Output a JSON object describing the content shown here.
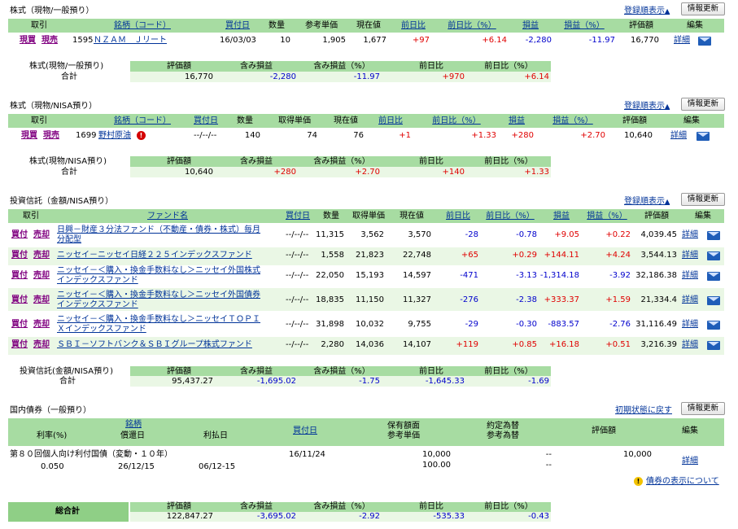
{
  "common": {
    "buy": "現買",
    "sell": "現売",
    "inv_buy": "買付",
    "inv_sell": "売却",
    "detail": "詳細",
    "info_update": "情報更新",
    "sort_show": "登録順表示",
    "sort_arrow": "▲"
  },
  "s1": {
    "title": "株式（現物/一般預り）",
    "headers": [
      "取引",
      "銘柄（コード）",
      "買付日",
      "数量",
      "参考単価",
      "現在値",
      "前日比",
      "前日比（%）",
      "損益",
      "損益（%）",
      "評価額",
      "編集"
    ],
    "row": {
      "code": "1595",
      "name": "ＮＺＡＭ　Ｊリート",
      "date": "16/03/03",
      "qty": "10",
      "ref": "1,905",
      "price": "1,677",
      "chg": "+97",
      "chgp": "+6.14",
      "pl": "-2,280",
      "plp": "-11.97",
      "val": "16,770"
    },
    "sum_label1": "株式(現物/一般預り)",
    "sum_label2": "合計",
    "sum_headers": [
      "評価額",
      "含み損益",
      "含み損益（%）",
      "前日比",
      "前日比（%）"
    ],
    "sum": [
      "16,770",
      "-2,280",
      "-11.97",
      "+970",
      "+6.14"
    ]
  },
  "s2": {
    "title": "株式（現物/NISA預り）",
    "headers": [
      "取引",
      "銘柄（コード）",
      "買付日",
      "数量",
      "取得単価",
      "現在値",
      "前日比",
      "前日比（%）",
      "損益",
      "損益（%）",
      "評価額",
      "編集"
    ],
    "row": {
      "code": "1699",
      "name": "野村原油",
      "date": "--/--/--",
      "qty": "140",
      "ref": "74",
      "price": "76",
      "chg": "+1",
      "chgp": "+1.33",
      "pl": "+280",
      "plp": "+2.70",
      "val": "10,640"
    },
    "sum_label1": "株式(現物/NISA預り)",
    "sum_label2": "合計",
    "sum_headers": [
      "評価額",
      "含み損益",
      "含み損益（%）",
      "前日比",
      "前日比（%）"
    ],
    "sum": [
      "10,640",
      "+280",
      "+2.70",
      "+140",
      "+1.33"
    ]
  },
  "s3": {
    "title": "投資信託（金額/NISA預り）",
    "headers": [
      "取引",
      "ファンド名",
      "買付日",
      "数量",
      "取得単価",
      "現在値",
      "前日比",
      "前日比（%）",
      "損益",
      "損益（%）",
      "評価額",
      "編集"
    ],
    "rows": [
      {
        "n1": "日興－財産３分法ファンド（不動産・債券・株式）毎月",
        "n2": "分配型",
        "date": "--/--/--",
        "qty": "11,315",
        "ref": "3,562",
        "price": "3,570",
        "chg": "-28",
        "chgp": "-0.78",
        "pl": "+9.05",
        "plp": "+0.22",
        "val": "4,039.45"
      },
      {
        "n1": "ニッセイ－ニッセイ日経２２５インデックスファンド",
        "n2": "",
        "date": "--/--/--",
        "qty": "1,558",
        "ref": "21,823",
        "price": "22,748",
        "chg": "+65",
        "chgp": "+0.29",
        "pl": "+144.11",
        "plp": "+4.24",
        "val": "3,544.13"
      },
      {
        "n1": "ニッセイ－＜購入・換金手数料なし＞ニッセイ外国株式",
        "n2": "インデックスファンド",
        "date": "--/--/--",
        "qty": "22,050",
        "ref": "15,193",
        "price": "14,597",
        "chg": "-471",
        "chgp": "-3.13",
        "pl": "-1,314.18",
        "plp": "-3.92",
        "val": "32,186.38"
      },
      {
        "n1": "ニッセイ－＜購入・換金手数料なし＞ニッセイ外国債券",
        "n2": "インデックスファンド",
        "date": "--/--/--",
        "qty": "18,835",
        "ref": "11,150",
        "price": "11,327",
        "chg": "-276",
        "chgp": "-2.38",
        "pl": "+333.37",
        "plp": "+1.59",
        "val": "21,334.4"
      },
      {
        "n1": "ニッセイ－＜購入・換金手数料なし＞ニッセイＴＯＰＩ",
        "n2": "Ｘインデックスファンド",
        "date": "--/--/--",
        "qty": "31,898",
        "ref": "10,032",
        "price": "9,755",
        "chg": "-29",
        "chgp": "-0.30",
        "pl": "-883.57",
        "plp": "-2.76",
        "val": "31,116.49"
      },
      {
        "n1": "ＳＢＩ－ソフトバンク＆ＳＢＩグループ株式ファンド",
        "n2": "",
        "date": "--/--/--",
        "qty": "2,280",
        "ref": "14,036",
        "price": "14,107",
        "chg": "+119",
        "chgp": "+0.85",
        "pl": "+16.18",
        "plp": "+0.51",
        "val": "3,216.39"
      }
    ],
    "sum_label1": "投資信託(金額/NISA預り)",
    "sum_label2": "合計",
    "sum_headers": [
      "評価額",
      "含み損益",
      "含み損益（%）",
      "前日比",
      "前日比（%）"
    ],
    "sum": [
      "95,437.27",
      "-1,695.02",
      "-1.75",
      "-1,645.33",
      "-1.69"
    ]
  },
  "s4": {
    "title": "国内債券（一般預り）",
    "reset_link": "初期状態に戻す",
    "h_rate": "利率(%)",
    "h_brand": "銘柄",
    "h_redeem": "償還日",
    "h_pay": "利払日",
    "h_buydate": "買付日",
    "h_face1": "保有額面",
    "h_face2": "参考単価",
    "h_fx1": "約定為替",
    "h_fx2": "参考為替",
    "h_val": "評価額",
    "h_edit": "編集",
    "row": {
      "name": "第８０回個人向け利付国債（変動・１０年）",
      "rate": "0.050",
      "redeem": "26/12/15",
      "pay": "06/12-15",
      "date": "16/11/24",
      "face": "10,000",
      "unit": "100.00",
      "fx1": "--",
      "fx2": "--",
      "val": "10,000"
    },
    "note_link": "債券の表示について"
  },
  "total": {
    "label": "総合計",
    "headers": [
      "評価額",
      "含み損益",
      "含み損益（%）",
      "前日比",
      "前日比（%）"
    ],
    "values": [
      "122,847.27",
      "-3,695.02",
      "-2.92",
      "-535.33",
      "-0.43"
    ]
  }
}
